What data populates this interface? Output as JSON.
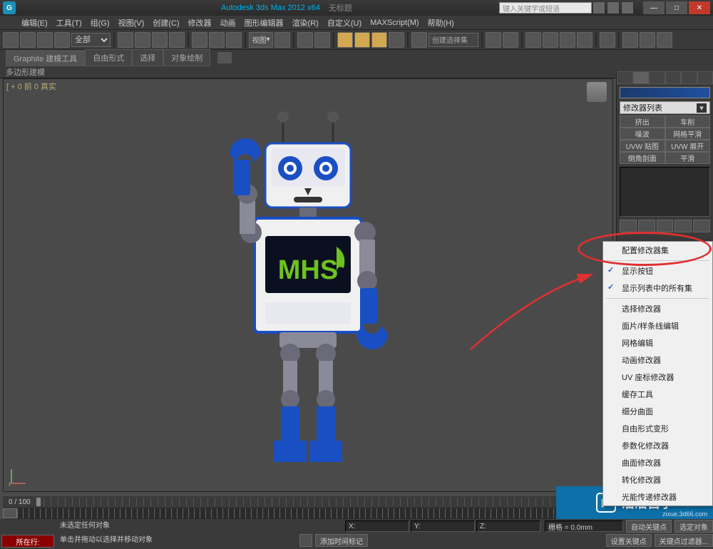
{
  "title": {
    "app": "Autodesk 3ds Max  2012 x64",
    "doc": "无标题"
  },
  "search_placeholder": "键入关键字或短语",
  "menus": [
    "编辑(E)",
    "工具(T)",
    "组(G)",
    "视图(V)",
    "创建(C)",
    "修改器",
    "动画",
    "图形编辑器",
    "渲染(R)",
    "自定义(U)",
    "MAXScript(M)",
    "帮助(H)"
  ],
  "toolbar": {
    "scope": "全部",
    "view_label": "视图",
    "create_mode": "创建选择集"
  },
  "ribbon": {
    "tabs": [
      "Graphite 建模工具",
      "自由形式",
      "选择",
      "对象绘制"
    ],
    "subpanel": "多边形建模"
  },
  "viewport_label": "[ + 0 前 0 真实",
  "command_panel": {
    "modifier_list": "修改器列表",
    "buttons": [
      "挤出",
      "车削",
      "噪波",
      "网格平滑",
      "UVW 贴图",
      "UVW 展开",
      "倒角剖面",
      "平滑"
    ]
  },
  "context_menu": {
    "title_item": "配置修改器集",
    "checked": [
      "显示按钮",
      "显示列表中的所有集"
    ],
    "items": [
      "选择修改器",
      "面片/样条线编辑",
      "网格编辑",
      "动画修改器",
      "UV 座标修改器",
      "缓存工具",
      "细分曲面",
      "自由形式变形",
      "参数化修改器",
      "曲面修改器",
      "转化修改器",
      "光能传递修改器"
    ]
  },
  "timeline": {
    "range": "0 / 100",
    "frame": "0"
  },
  "status": {
    "current_btn": "所在行:",
    "prompt1": "未选定任何对象",
    "prompt2": "单击并拖动以选择并移动对象",
    "coords": {
      "x": "X:",
      "y": "Y:",
      "z": "Z:"
    },
    "grid": "栅格 = 0.0mm",
    "auto_key": "自动关键点",
    "sel_lock": "选定对象",
    "set_key": "设置关键点",
    "key_filters": "关键点过滤器...",
    "add_time": "添加时间标记"
  },
  "robot_text": "MHS",
  "watermark": {
    "text": "溜溜自学",
    "url": "zixue.3d66.com"
  }
}
